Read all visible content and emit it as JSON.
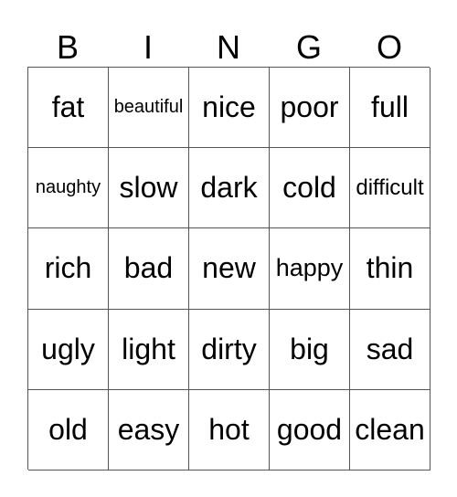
{
  "header": [
    "B",
    "I",
    "N",
    "G",
    "O"
  ],
  "cells": [
    [
      "fat",
      "beautiful",
      "nice",
      "poor",
      "full"
    ],
    [
      "naughty",
      "slow",
      "dark",
      "cold",
      "difficult"
    ],
    [
      "rich",
      "bad",
      "new",
      "happy",
      "thin"
    ],
    [
      "ugly",
      "light",
      "dirty",
      "big",
      "sad"
    ],
    [
      "old",
      "easy",
      "hot",
      "good",
      "clean"
    ]
  ]
}
